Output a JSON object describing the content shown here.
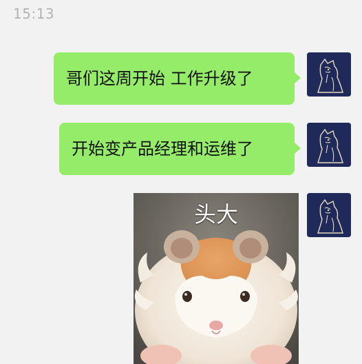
{
  "chat": {
    "timestamp": "15:13",
    "messages": [
      {
        "type": "text",
        "text": "哥们这周开始 工作升级了"
      },
      {
        "type": "text",
        "text": "开始变产品经理和运维了"
      },
      {
        "type": "sticker",
        "caption": "头大",
        "icon": "hamster-sticker"
      }
    ]
  },
  "colors": {
    "background": "#f2f2f2",
    "bubble": "#95ec69",
    "timestamp": "#b3b3b3",
    "avatar_bg": "#1f2a5b"
  }
}
